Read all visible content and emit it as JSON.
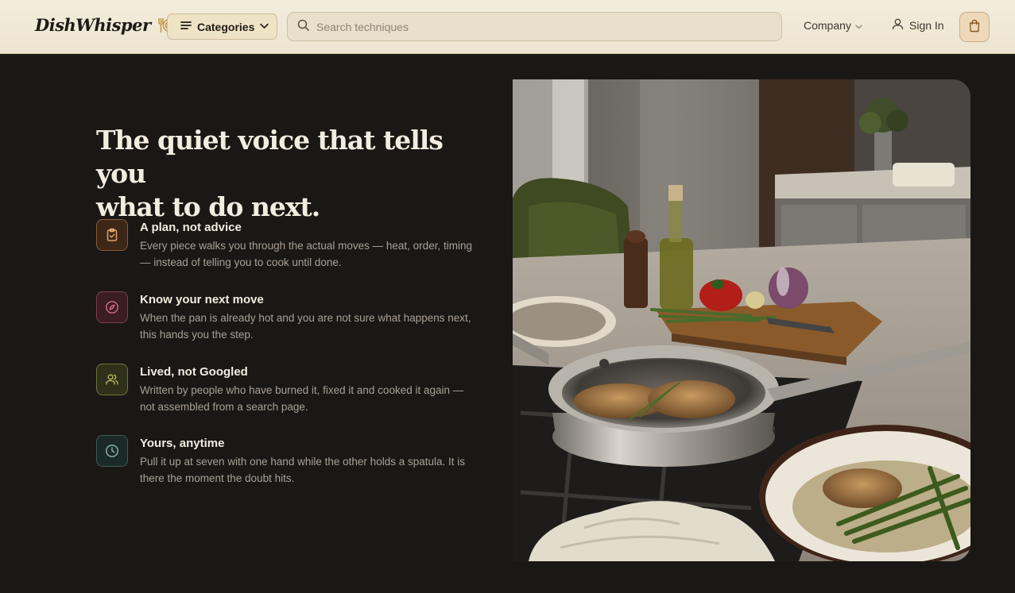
{
  "header": {
    "logo": "DishWhisper",
    "categories_label": "Categories",
    "search_placeholder": "Search techniques",
    "company_label": "Company",
    "signin_label": "Sign In"
  },
  "hero": {
    "headline_line1": "The quiet voice that tells you",
    "headline_line2": "what to do next.",
    "features": [
      {
        "icon": "clipboard-check-icon",
        "title": "A plan, not advice",
        "desc": "Every piece walks you through the actual moves — heat, order, timing — instead of telling you to cook until done."
      },
      {
        "icon": "compass-icon",
        "title": "Know your next move",
        "desc": "When the pan is already hot and you are not sure what happens next, this hands you the step."
      },
      {
        "icon": "users-icon",
        "title": "Lived, not Googled",
        "desc": "Written by people who have burned it, fixed it and cooked it again — not assembled from a search page."
      },
      {
        "icon": "clock-icon",
        "title": "Yours, anytime",
        "desc": "Pull it up at seven with one hand while the other holds a spatula. It is there the moment the doubt hits."
      }
    ]
  },
  "colors": {
    "background": "#1b1715",
    "header": "#efe8d6",
    "accent": "#c9a24a"
  }
}
